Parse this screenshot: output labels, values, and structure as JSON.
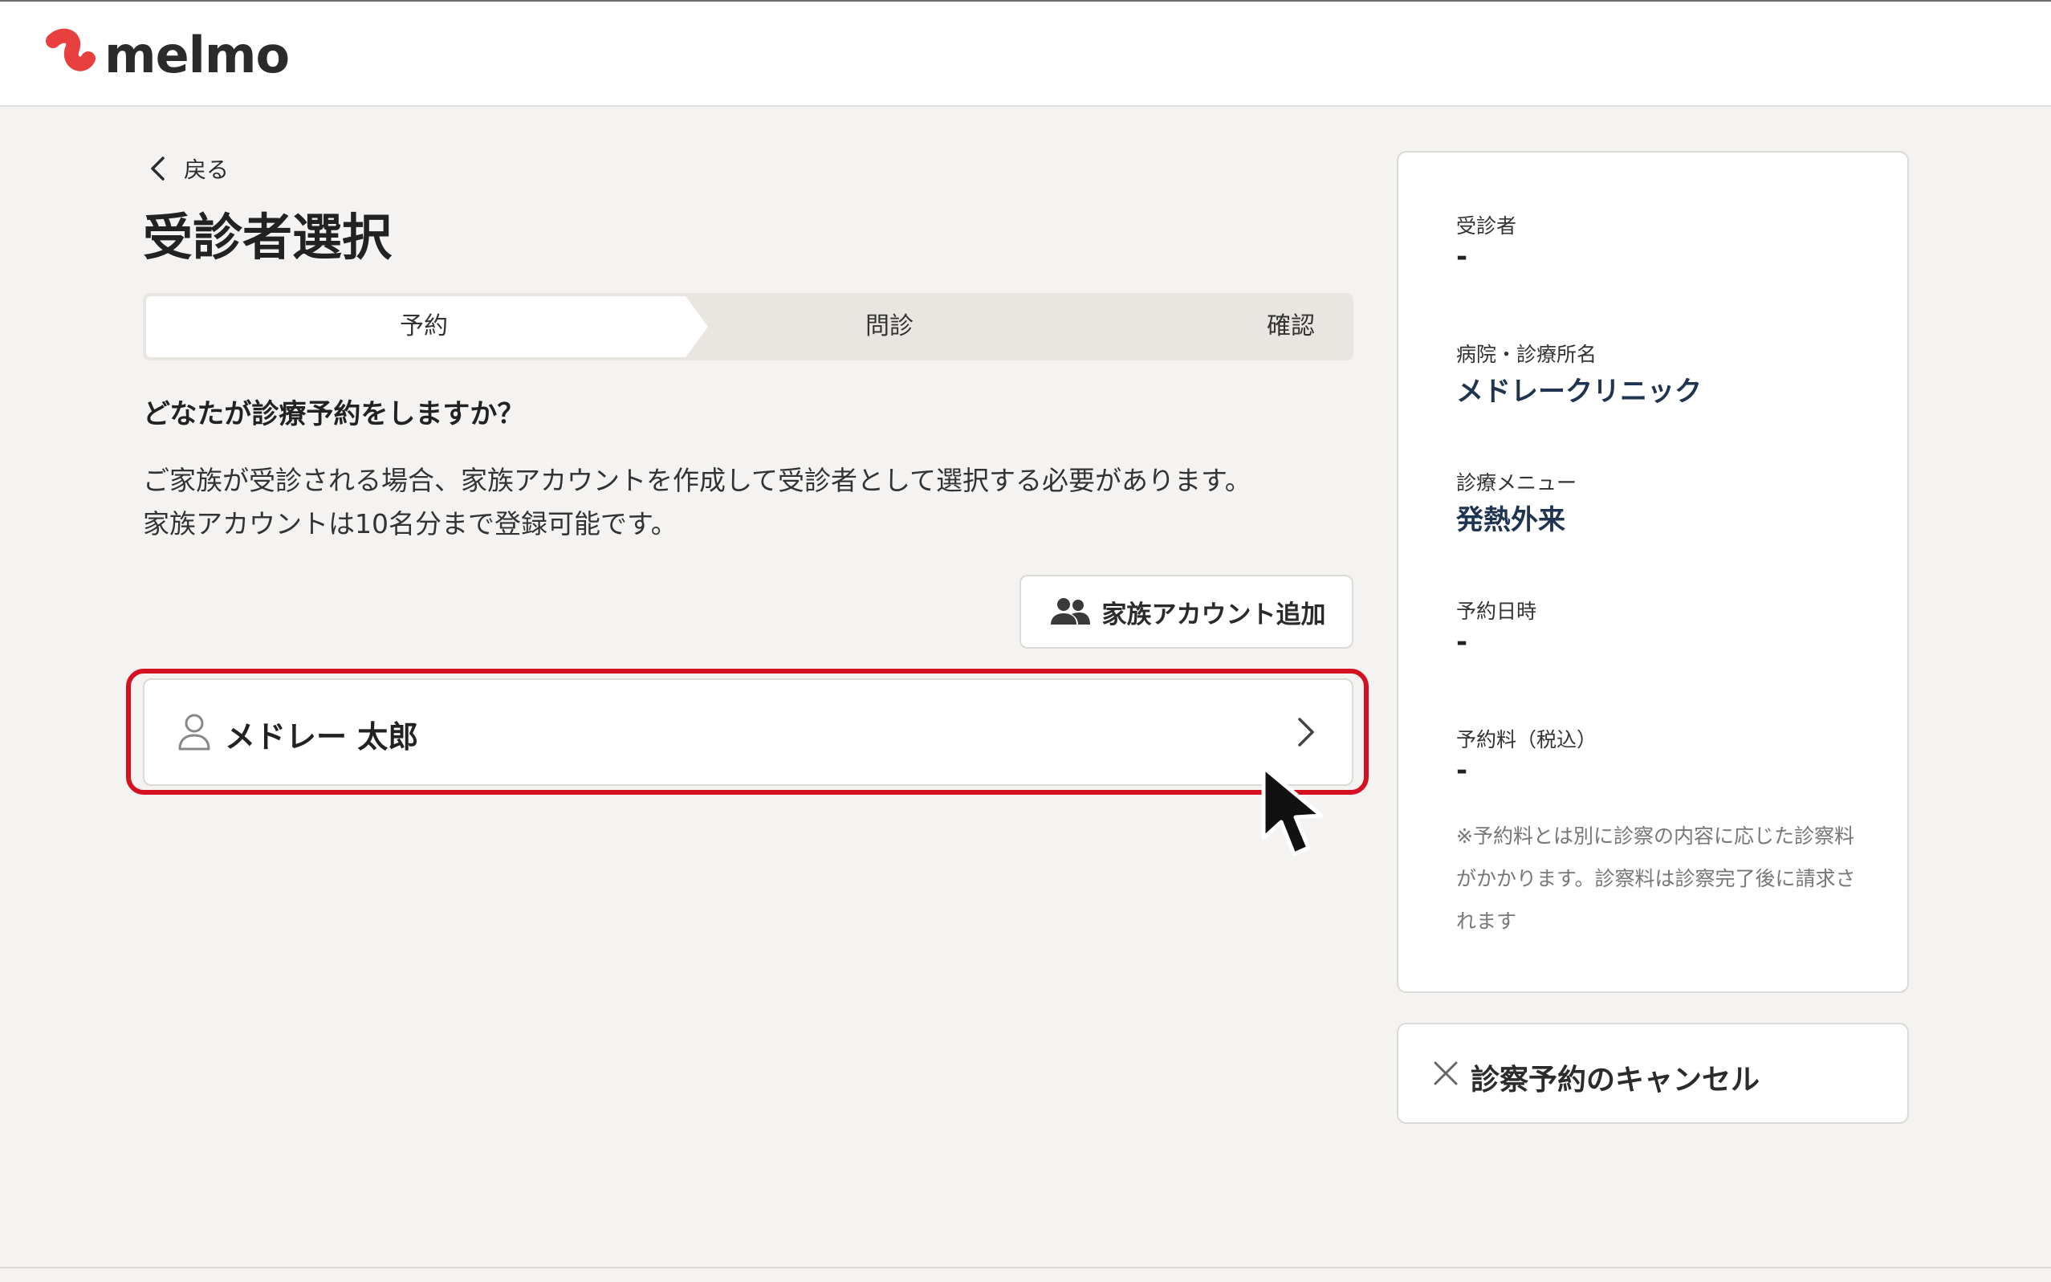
{
  "header": {
    "logo_text": "melmo",
    "brand_color": "#e8403f"
  },
  "nav": {
    "back_label": "戻る"
  },
  "page": {
    "title": "受診者選択"
  },
  "steps": [
    {
      "label": "予約",
      "active": true
    },
    {
      "label": "問診",
      "active": false
    },
    {
      "label": "確認",
      "active": false
    }
  ],
  "content": {
    "question": "どなたが診療予約をしますか？",
    "description_line1": "ご家族が受診される場合、家族アカウントを作成して受診者として選択する必要があります。",
    "description_line2": "家族アカウントは10名分まで登録可能です。",
    "add_family_button": "家族アカウント追加",
    "patient_name": "メドレー 太郎",
    "highlight_color": "#d51020"
  },
  "summary": {
    "patient_label": "受診者",
    "patient_value": "-",
    "clinic_label": "病院・診療所名",
    "clinic_value": "メドレークリニック",
    "menu_label": "診療メニュー",
    "menu_value": "発熱外来",
    "datetime_label": "予約日時",
    "datetime_value": "-",
    "fee_label": "予約料（税込）",
    "fee_value": "-",
    "note": "※予約料とは別に診察の内容に応じた診察料がかかります。診察料は診察完了後に請求されます",
    "value_color": "#1f3451"
  },
  "cancel": {
    "label": "診察予約のキャンセル"
  }
}
